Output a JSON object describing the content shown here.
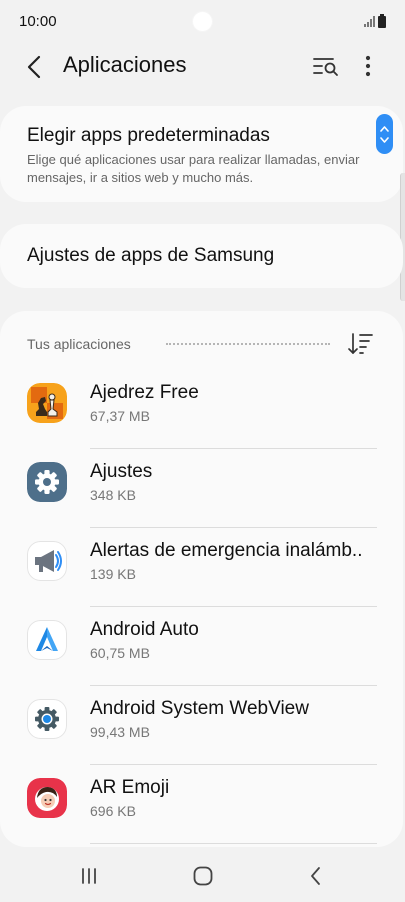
{
  "status_bar": {
    "time": "10:00"
  },
  "app_bar": {
    "title": "Aplicaciones"
  },
  "default_apps": {
    "title": "Elegir apps predeterminadas",
    "subtitle": "Elige qué aplicaciones usar para realizar llamadas, enviar mensajes, ir a sitios web y mucho más."
  },
  "samsung_settings": {
    "title": "Ajustes de apps de Samsung"
  },
  "app_list": {
    "section_label": "Tus aplicaciones",
    "apps": [
      {
        "name": "Ajedrez Free",
        "size": "67,37 MB",
        "icon": "chess-icon"
      },
      {
        "name": "Ajustes",
        "size": "348 KB",
        "icon": "settings-gear-icon"
      },
      {
        "name": "Alertas de emergencia inalámb..",
        "size": "139 KB",
        "icon": "megaphone-icon"
      },
      {
        "name": "Android Auto",
        "size": "60,75 MB",
        "icon": "android-auto-icon"
      },
      {
        "name": "Android System WebView",
        "size": "99,43 MB",
        "icon": "webview-gear-icon"
      },
      {
        "name": "AR Emoji",
        "size": "696 KB",
        "icon": "ar-emoji-icon"
      }
    ]
  },
  "colors": {
    "accent": "#2f8ef5",
    "background": "#f2f2f2",
    "card": "#fafafa"
  }
}
